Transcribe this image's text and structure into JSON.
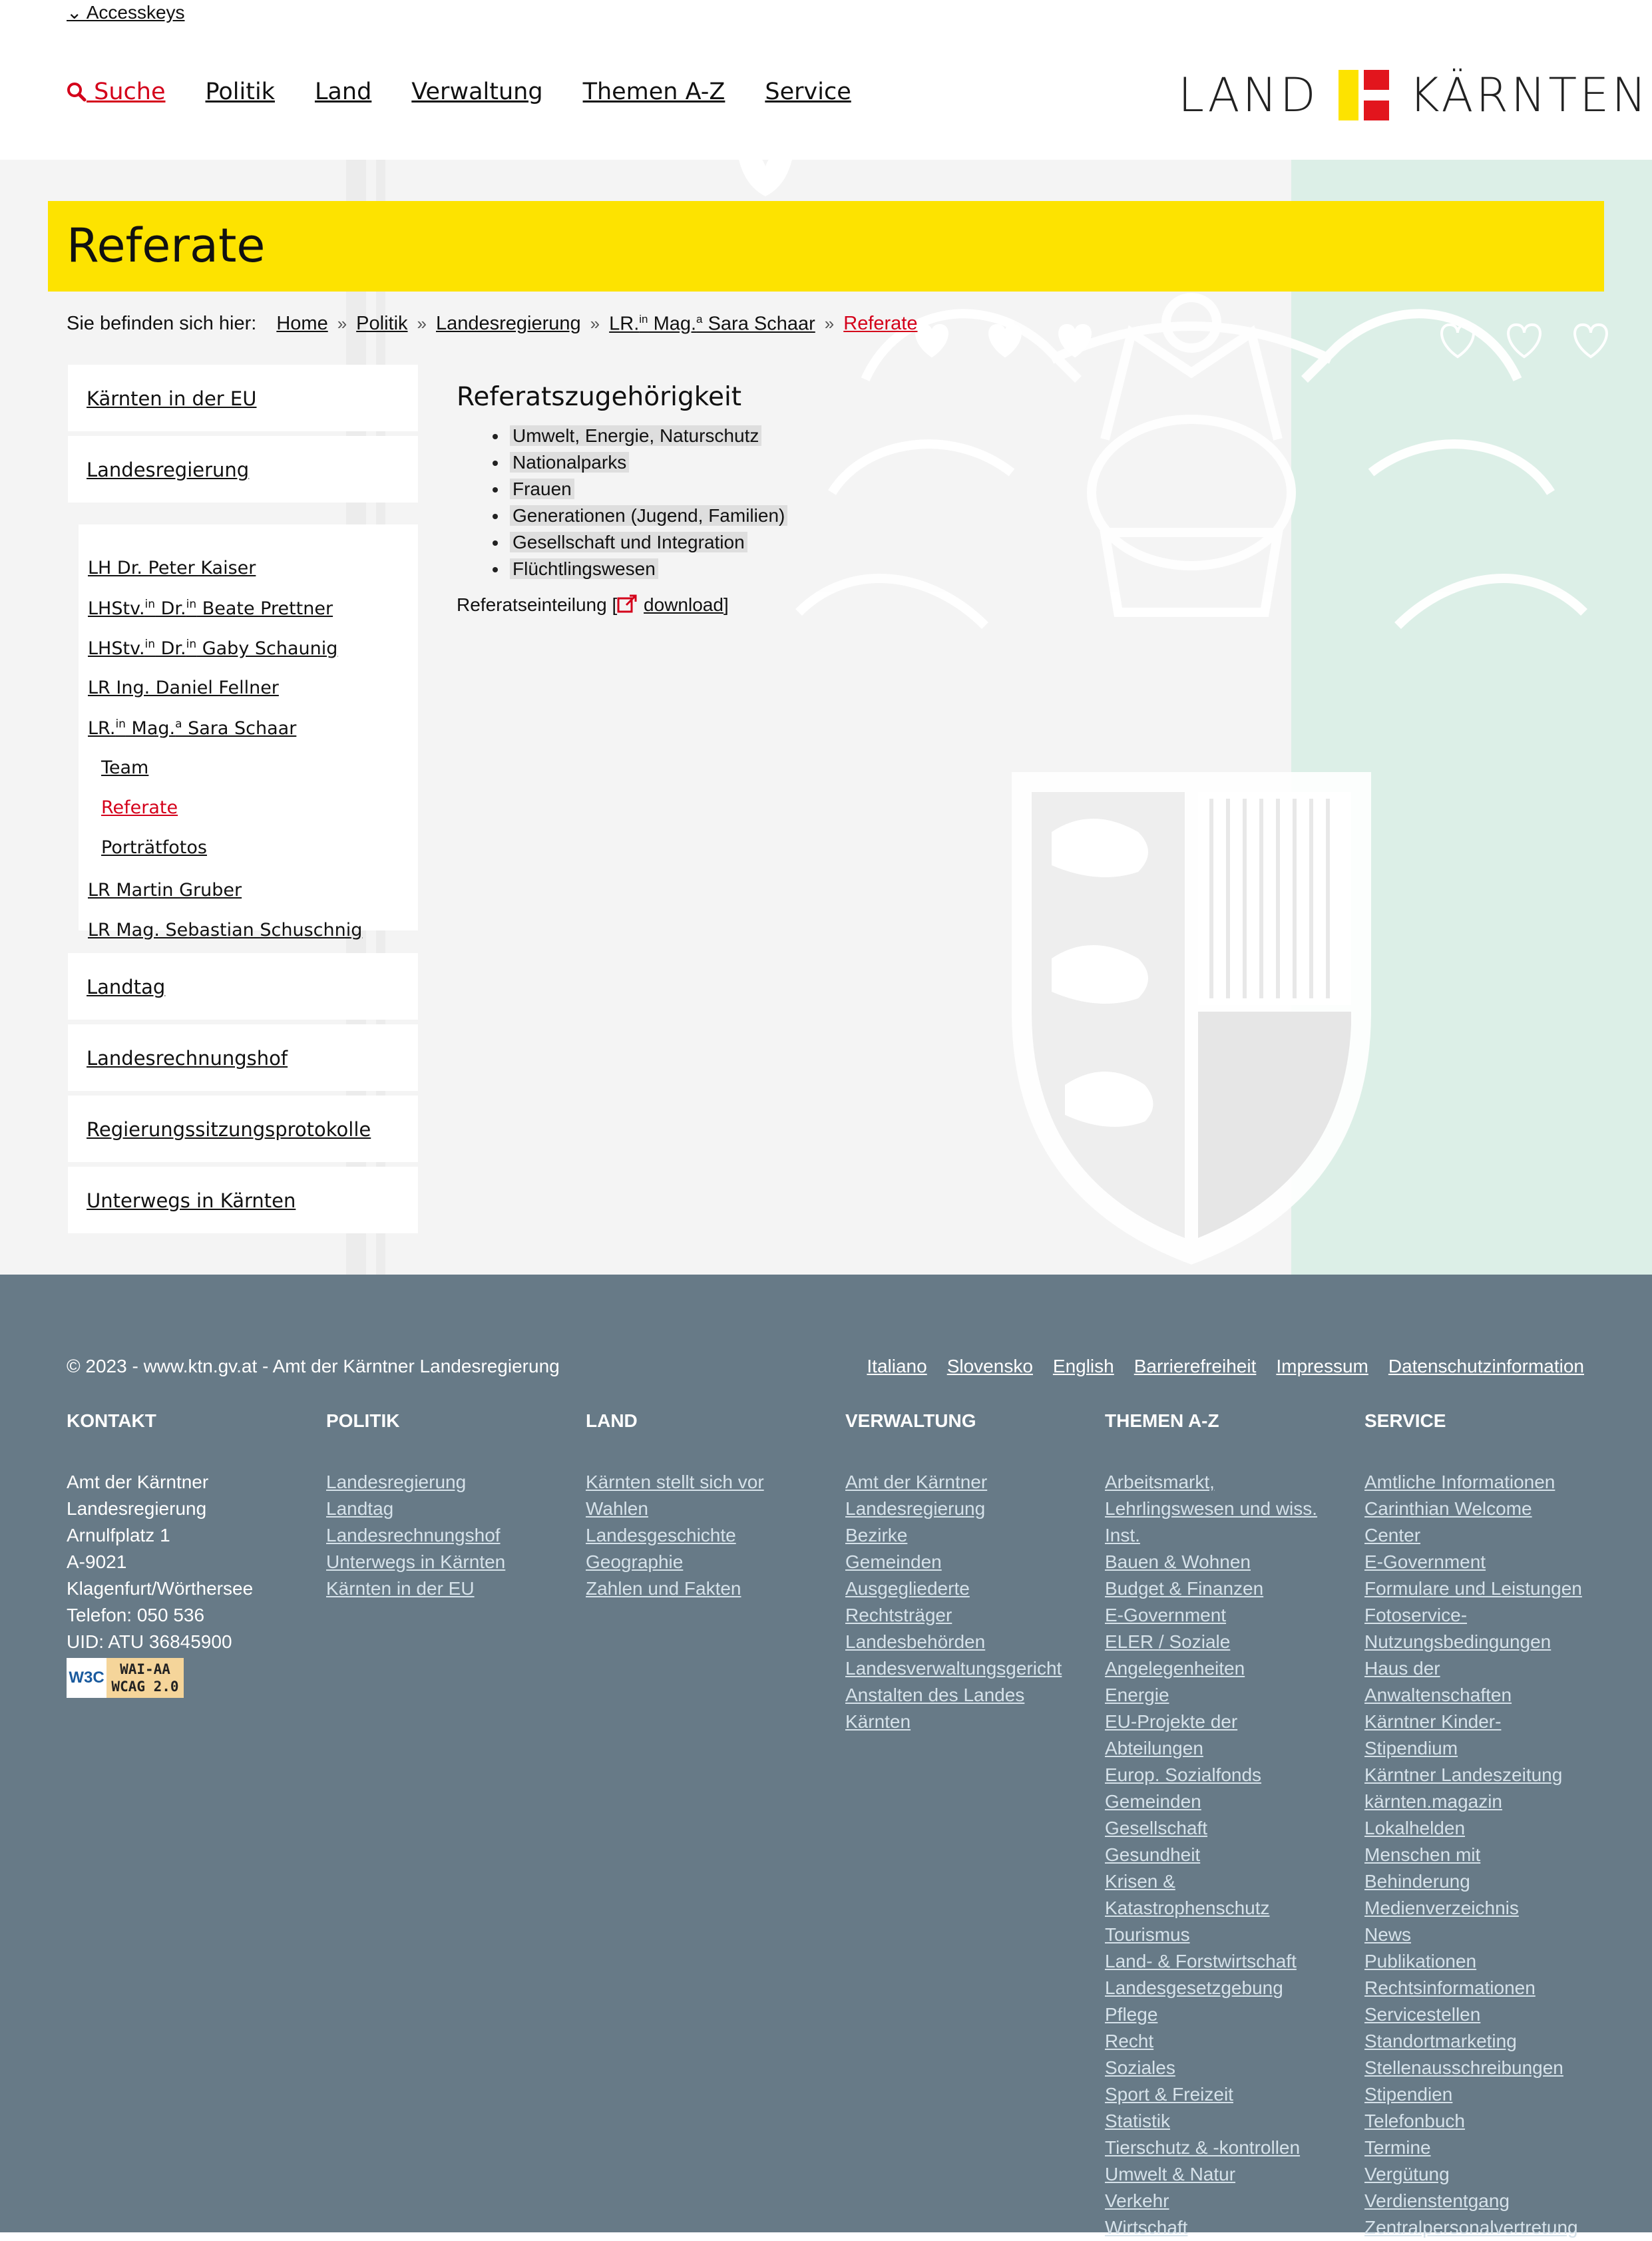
{
  "header": {
    "accesskeys": "⌄ Accesskeys",
    "nav": {
      "search": "Suche",
      "items": [
        "Politik",
        "Land",
        "Verwaltung",
        "Themen A-Z",
        "Service"
      ]
    },
    "logo": {
      "left": "LAND",
      "right": "KÄRNTEN"
    }
  },
  "page": {
    "title": "Referate"
  },
  "breadcrumb": {
    "label": "Sie befinden sich hier:",
    "items": [
      "Home",
      "Politik",
      "Landesregierung"
    ],
    "lr_prefix": "LR.",
    "lr_sup1": "in",
    "lr_mid": " Mag.",
    "lr_sup2": "a",
    "lr_name": " Sara Schaar",
    "current": "Referate"
  },
  "sidebar": {
    "top": [
      "Kärnten in der EU",
      "Landesregierung"
    ],
    "sub": {
      "kaiser": "LH Dr. Peter Kaiser",
      "prettner": {
        "a": "LHStv.",
        "s1": "in",
        "b": " Dr.",
        "s2": "in",
        "c": " Beate Prettner"
      },
      "schaunig": {
        "a": "LHStv.",
        "s1": "in",
        "b": " Dr.",
        "s2": "in",
        "c": " Gaby Schaunig"
      },
      "fellner": "LR Ing. Daniel Fellner",
      "schaar": {
        "a": "LR.",
        "s1": "in",
        "b": " Mag.",
        "s2": "a",
        "c": " Sara Schaar"
      },
      "team": "Team",
      "referate": "Referate",
      "portrait": "Porträtfotos",
      "gruber": "LR Martin Gruber",
      "schuschnig": "LR Mag. Sebastian Schuschnig"
    },
    "bottom": [
      "Landtag",
      "Landesrechnungshof",
      "Regierungssitzungsprotokolle",
      "Unterwegs in Kärnten"
    ]
  },
  "content": {
    "heading": "Referatszugehörigkeit",
    "items": [
      "Umwelt, Energie, Naturschutz",
      "Nationalparks",
      "Frauen",
      "Generationen (Jugend, Familien)",
      "Gesellschaft und Integration",
      "Flüchtlingswesen"
    ],
    "download_label": "Referatseinteilung [",
    "download_link": "download",
    "download_close": "]"
  },
  "footer": {
    "copyright": "© 2023 - www.ktn.gv.at - Amt der Kärntner Landesregierung",
    "links": [
      "Italiano",
      "Slovensko",
      "English",
      "Barrierefreiheit",
      "Impressum",
      "Datenschutzinformation"
    ],
    "kontakt": {
      "head": "KONTAKT",
      "lines": [
        "Amt der Kärntner",
        "Landesregierung",
        "Arnulfplatz 1",
        "A-9021",
        "Klagenfurt/Wörthersee",
        "Telefon: 050 536",
        "UID: ATU 36845900"
      ],
      "badge_w3c": "W3C",
      "badge_line1": "WAI-AA",
      "badge_line2": "WCAG 2.0"
    },
    "politik": {
      "head": "POLITIK",
      "links": [
        "Landesregierung",
        "Landtag",
        "Landesrechnungshof",
        "Unterwegs in Kärnten",
        "Kärnten in der EU"
      ]
    },
    "land": {
      "head": "LAND",
      "links": [
        "Kärnten stellt sich vor",
        "Wahlen",
        "Landesgeschichte",
        "Geographie",
        "Zahlen und Fakten"
      ]
    },
    "verwaltung": {
      "head": "VERWALTUNG",
      "links": [
        "Amt der Kärntner",
        "Landesregierung",
        "Bezirke",
        "Gemeinden",
        "Ausgegliederte",
        "Rechtsträger",
        "Landesbehörden",
        "Landesverwaltungsgericht",
        "Anstalten des Landes",
        "Kärnten"
      ]
    },
    "themen": {
      "head": "THEMEN A-Z",
      "links": [
        "Arbeitsmarkt,",
        "Lehrlingswesen und wiss.",
        "Inst.",
        "Bauen & Wohnen",
        "Budget & Finanzen",
        "E-Government",
        "ELER / Soziale",
        "Angelegenheiten",
        "Energie",
        "EU-Projekte der",
        "Abteilungen",
        "Europ. Sozialfonds",
        "Gemeinden",
        "Gesellschaft",
        "Gesundheit",
        "Krisen &",
        "Katastrophenschutz",
        "Tourismus",
        "Land- & Forstwirtschaft",
        "Landesgesetzgebung",
        "Pflege",
        "Recht",
        "Soziales",
        "Sport & Freizeit",
        "Statistik",
        "Tierschutz & -kontrollen",
        "Umwelt & Natur",
        "Verkehr",
        "Wirtschaft"
      ]
    },
    "service": {
      "head": "SERVICE",
      "links": [
        "Amtliche Informationen",
        "Carinthian Welcome",
        "Center",
        "E-Government",
        "Formulare und Leistungen",
        "Fotoservice-",
        "Nutzungsbedingungen",
        "Haus der",
        "Anwaltenschaften",
        "Kärntner Kinder-",
        "Stipendium",
        "Kärntner Landeszeitung",
        "kärnten.magazin",
        "Lokalhelden",
        "Menschen mit",
        "Behinderung",
        "Medienverzeichnis",
        "News",
        "Publikationen",
        "Rechtsinformationen",
        "Servicestellen",
        "Standortmarketing",
        "Stellenausschreibungen",
        "Stipendien",
        "Telefonbuch",
        "Termine",
        "Vergütung",
        "Verdienstentgang",
        "Zentralpersonalvertretung"
      ]
    }
  },
  "colors": {
    "accent_red": "#d4001a",
    "title_yellow": "#fde300",
    "footer_bg": "#677a87",
    "mint": "#dcefe7"
  },
  "icons": [
    "search-icon",
    "external-link-icon",
    "chevron-right-icon",
    "chevron-down-icon"
  ]
}
